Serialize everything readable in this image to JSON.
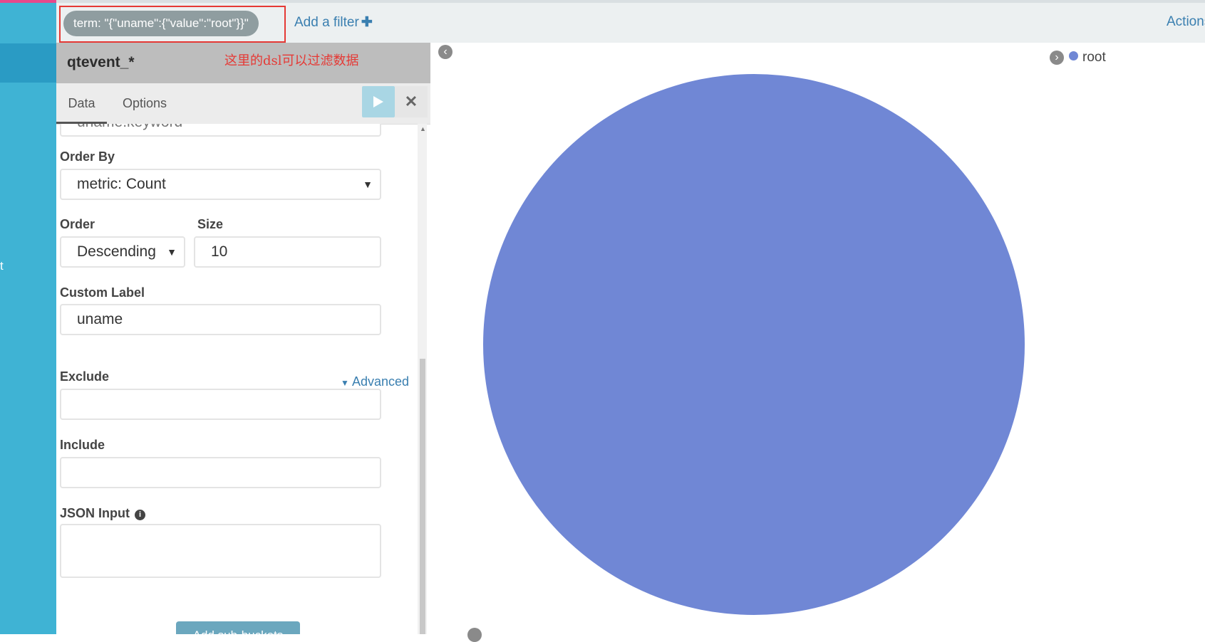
{
  "left_nav": {
    "partial_label": "t"
  },
  "filter_bar": {
    "filter_pill": "term: \"{\"uname\":{\"value\":\"root\"}}\"",
    "add_filter_label": "Add a filter",
    "action_label": "Actions"
  },
  "editor": {
    "index_pattern": "qtevent_*",
    "annotation": "这里的dsl可以过滤数据",
    "tabs": [
      {
        "label": "Data"
      },
      {
        "label": "Options"
      }
    ],
    "field_partial": "uname.keyword",
    "order_by": {
      "label": "Order By",
      "value": "metric: Count"
    },
    "order": {
      "label": "Order",
      "value": "Descending"
    },
    "size": {
      "label": "Size",
      "value": "10"
    },
    "custom_label": {
      "label": "Custom Label",
      "value": "uname"
    },
    "advanced_label": "Advanced",
    "exclude": {
      "label": "Exclude",
      "value": ""
    },
    "include": {
      "label": "Include",
      "value": ""
    },
    "json_input": {
      "label": "JSON Input",
      "value": ""
    },
    "add_subbucket_label": "Add sub-buckets"
  },
  "chart_data": {
    "type": "pie",
    "categories": [
      "root"
    ],
    "values": [
      100
    ],
    "legend": [
      {
        "label": "root",
        "color": "#7087d5"
      }
    ],
    "legend_position": "top-right"
  }
}
